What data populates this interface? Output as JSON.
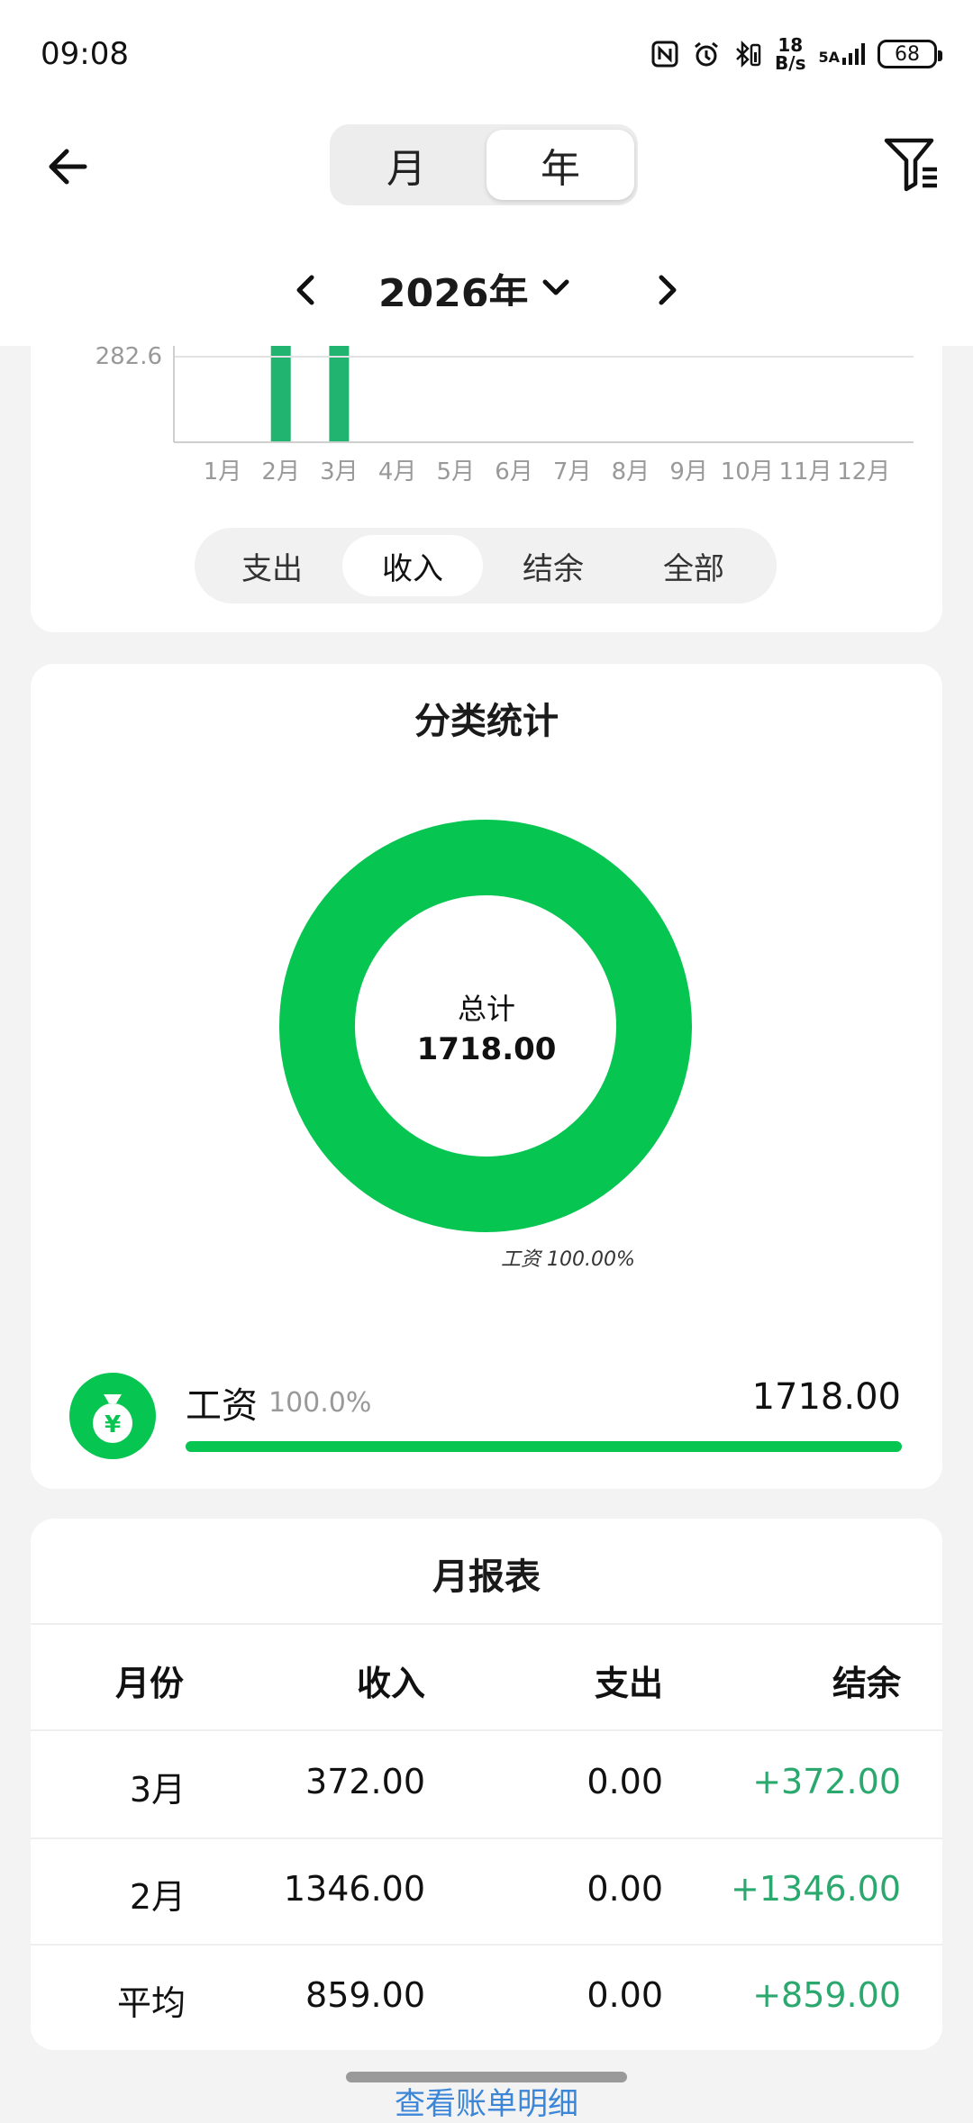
{
  "status_bar": {
    "time": "09:08",
    "net_speed_top": "18",
    "net_speed_bottom": "B/s",
    "signal_label": "5A",
    "battery": "68"
  },
  "header": {
    "seg_month": "月",
    "seg_year": "年",
    "selected_segment": "年",
    "year_label": "2026年"
  },
  "colors": {
    "accent_green": "#07c551",
    "bar_green": "#21b471",
    "positive_text": "#2ba86e",
    "link_blue": "#3c86d8"
  },
  "chart_data": {
    "type": "bar",
    "categories": [
      "1月",
      "2月",
      "3月",
      "4月",
      "5月",
      "6月",
      "7月",
      "8月",
      "9月",
      "10月",
      "11月",
      "12月"
    ],
    "values": [
      0,
      1346.0,
      372.0,
      0,
      0,
      0,
      0,
      0,
      0,
      0,
      0,
      0
    ],
    "ytick_label": "282.6",
    "ytick_value": 282.6,
    "bar_color": "#21b471"
  },
  "tabs": [
    "支出",
    "收入",
    "结余",
    "全部"
  ],
  "active_tab": "收入",
  "category_stats": {
    "title": "分类统计",
    "donut": {
      "total_label": "总计",
      "total_value": "1718.00",
      "caption": "工资 100.00%",
      "slices": [
        {
          "name": "工资",
          "value": 1718.0,
          "percent": 100.0,
          "color": "#07c551"
        }
      ]
    },
    "items": [
      {
        "name": "工资",
        "percent_text": "100.0%",
        "amount": "1718.00",
        "fraction": 1.0,
        "icon": "money-bag-icon"
      }
    ]
  },
  "monthly_report": {
    "title": "月报表",
    "headers": [
      "月份",
      "收入",
      "支出",
      "结余"
    ],
    "rows": [
      {
        "month": "3月",
        "income": "372.00",
        "expense": "0.00",
        "balance": "+372.00"
      },
      {
        "month": "2月",
        "income": "1346.00",
        "expense": "0.00",
        "balance": "+1346.00"
      },
      {
        "month": "平均",
        "income": "859.00",
        "expense": "0.00",
        "balance": "+859.00"
      }
    ]
  },
  "bottom_link": "查看账单明细"
}
